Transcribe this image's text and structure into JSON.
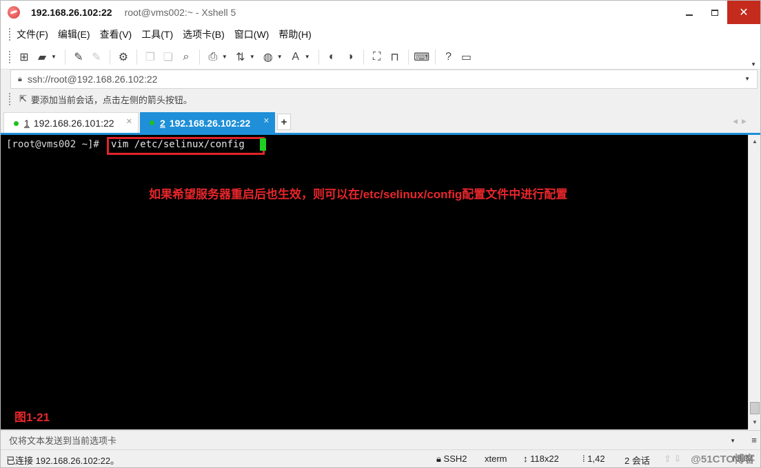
{
  "window": {
    "host_title": "192.168.26.102:22",
    "title_rest": "root@vms002:~ - Xshell 5",
    "minimize_glyph": "",
    "close_glyph": "✕"
  },
  "menu": {
    "items": [
      "文件(F)",
      "编辑(E)",
      "查看(V)",
      "工具(T)",
      "选项卡(B)",
      "窗口(W)",
      "帮助(H)"
    ]
  },
  "toolbar": {
    "icons": [
      {
        "name": "new-session-icon",
        "glyph": "⊞",
        "dim": false,
        "drop": false
      },
      {
        "name": "open-folder-icon",
        "glyph": "▰",
        "dim": false,
        "drop": true
      },
      {
        "name": "reconnect-icon",
        "glyph": "✎",
        "dim": false,
        "drop": false
      },
      {
        "name": "disconnect-icon",
        "glyph": "✎",
        "dim": true,
        "drop": false
      },
      {
        "name": "properties-icon",
        "glyph": "⚙",
        "dim": false,
        "drop": false
      },
      {
        "name": "copy-icon",
        "glyph": "❐",
        "dim": true,
        "drop": false
      },
      {
        "name": "paste-icon",
        "glyph": "❏",
        "dim": true,
        "drop": false
      },
      {
        "name": "find-icon",
        "glyph": "⌕",
        "dim": false,
        "drop": false
      },
      {
        "name": "print-icon",
        "glyph": "⎙",
        "dim": false,
        "drop": true
      },
      {
        "name": "transfer-icon",
        "glyph": "⇅",
        "dim": false,
        "drop": true
      },
      {
        "name": "globe-icon",
        "glyph": "◍",
        "dim": false,
        "drop": true
      },
      {
        "name": "font-icon",
        "glyph": "A",
        "dim": false,
        "drop": true
      },
      {
        "name": "xftp-icon",
        "glyph": "◐",
        "dim": false,
        "drop": false
      },
      {
        "name": "xmanager-icon",
        "glyph": "◑",
        "dim": false,
        "drop": false
      },
      {
        "name": "fullscreen-icon",
        "glyph": "⛶",
        "dim": false,
        "drop": false
      },
      {
        "name": "lock-toolbar-icon",
        "glyph": "⊓",
        "dim": false,
        "drop": false
      },
      {
        "name": "keyboard-icon",
        "glyph": "⌨",
        "dim": false,
        "drop": false
      },
      {
        "name": "help-icon",
        "glyph": "?",
        "dim": false,
        "drop": false
      },
      {
        "name": "chat-icon",
        "glyph": "▭",
        "dim": false,
        "drop": false
      }
    ]
  },
  "address": {
    "value": "ssh://root@192.168.26.102:22"
  },
  "hint": {
    "text": "要添加当前会话，点击左侧的箭头按钮。"
  },
  "tabs": [
    {
      "num": "1",
      "label": "192.168.26.101:22",
      "active": false
    },
    {
      "num": "2",
      "label": "192.168.26.102:22",
      "active": true
    }
  ],
  "tab_add": "+",
  "terminal": {
    "prompt": "[root@vms002 ~]#",
    "command": "vim /etc/selinux/config",
    "annotation": "如果希望服务器重启后也生效，则可以在/etc/selinux/config配置文件中进行配置",
    "figure_label": "图1-21"
  },
  "sendbar": {
    "text": "仅将文本发送到当前选项卡"
  },
  "status": {
    "connection": "已连接 192.168.26.102:22。",
    "protocol": "SSH2",
    "term": "xterm",
    "size": "118x22",
    "cursor_pos": "1,42",
    "sessions": "2 会话",
    "num": "NUM",
    "watermark": "@51CTO博客"
  }
}
